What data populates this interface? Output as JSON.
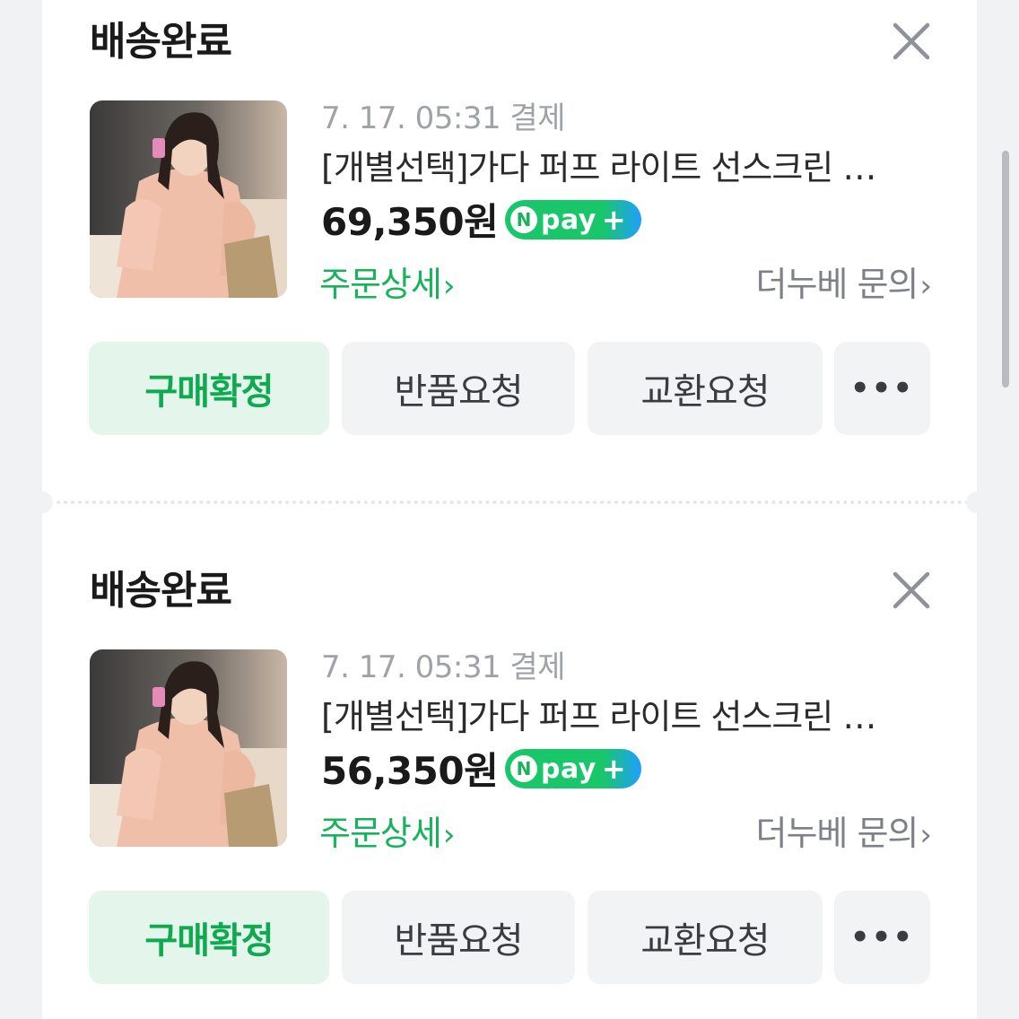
{
  "orders": [
    {
      "status": "배송완료",
      "date": "7. 17. 05:31 결제",
      "title": "[개별선택]가다 퍼프 라이트 선스크린 …",
      "price": "69,350원",
      "npay": {
        "n": "N",
        "pay": "pay",
        "plus": "+"
      },
      "detail_link": "주문상세",
      "inquiry_link": "더누베 문의",
      "buttons": {
        "confirm": "구매확정",
        "return": "반품요청",
        "exchange": "교환요청",
        "more": "•••"
      }
    },
    {
      "status": "배송완료",
      "date": "7. 17. 05:31 결제",
      "title": "[개별선택]가다 퍼프 라이트 선스크린 …",
      "price": "56,350원",
      "npay": {
        "n": "N",
        "pay": "pay",
        "plus": "+"
      },
      "detail_link": "주문상세",
      "inquiry_link": "더누베 문의",
      "buttons": {
        "confirm": "구매확정",
        "return": "반품요청",
        "exchange": "교환요청",
        "more": "•••"
      }
    }
  ],
  "icons": {
    "close": "close-icon",
    "chevron": "chevron-right-icon",
    "thumbnail": "product-photo"
  },
  "colors": {
    "accent_green": "#17b35a",
    "confirm_bg": "#e4f6ec",
    "button_bg": "#f2f3f5",
    "npay_blue": "#1f9fff"
  }
}
